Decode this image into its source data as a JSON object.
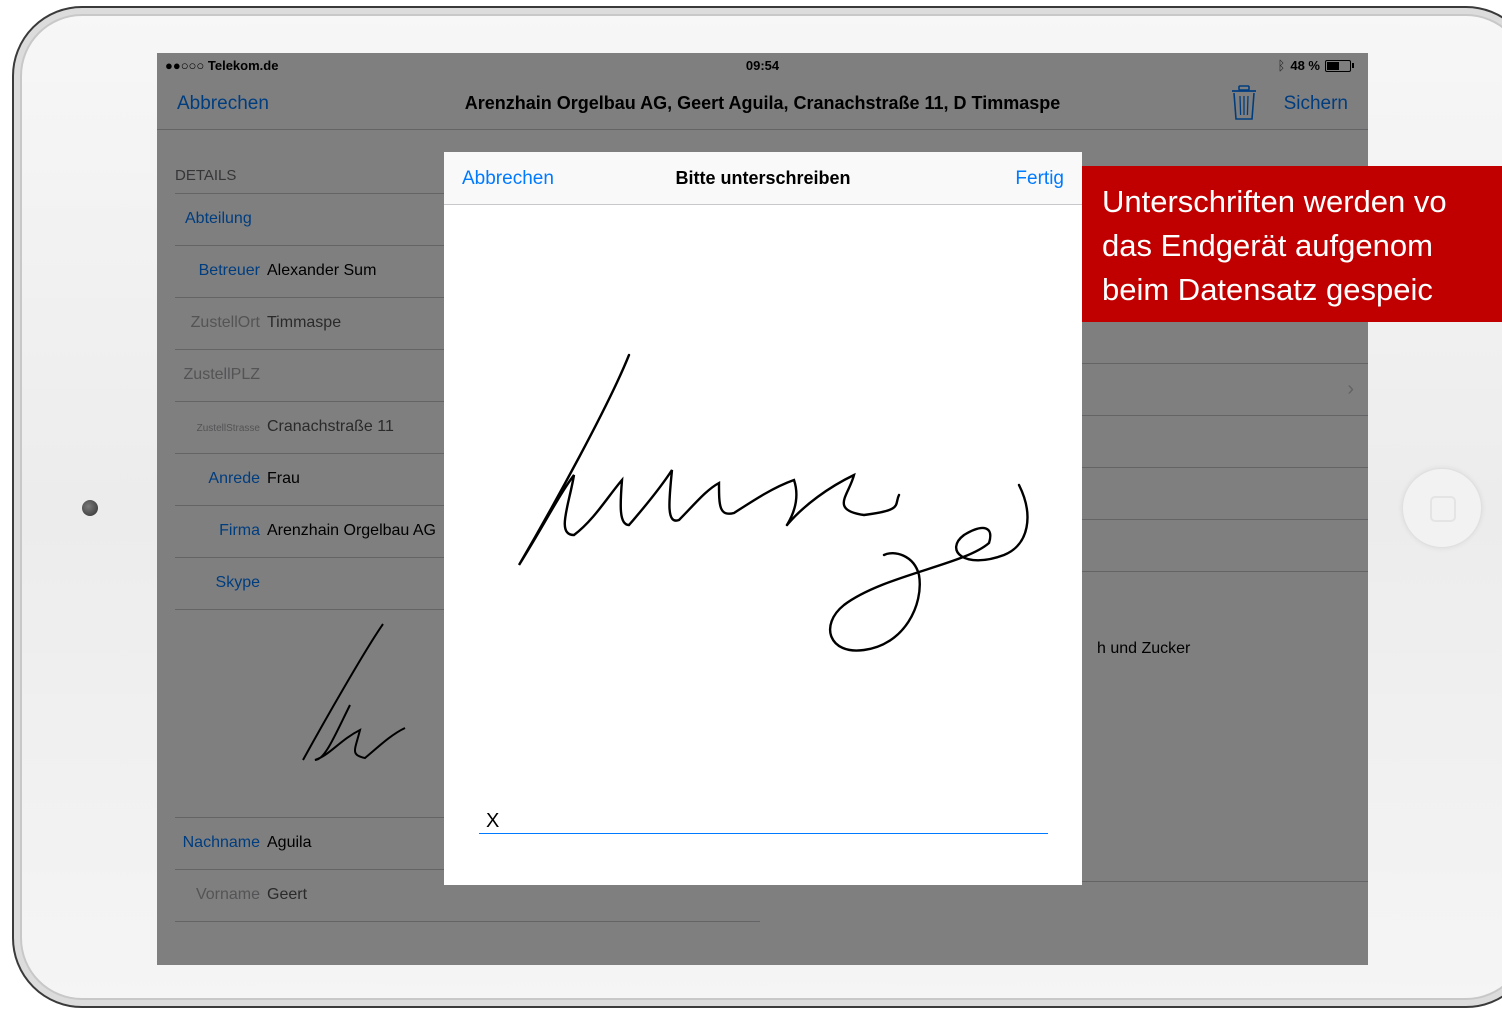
{
  "status_bar": {
    "carrier": "●●○○○ Telekom.de",
    "time": "09:54",
    "battery": "48 %"
  },
  "navbar": {
    "cancel": "Abbrechen",
    "title": "Arenzhain Orgelbau AG, Geert Aguila, Cranachstraße 11, D  Timmaspe",
    "save": "Sichern"
  },
  "details": {
    "header": "DETAILS",
    "rows": [
      {
        "label": "Abteilung",
        "value": ""
      },
      {
        "label": "Betreuer",
        "value": "Alexander Sum"
      },
      {
        "label": "ZustellOrt",
        "value": "Timmaspe"
      },
      {
        "label": "ZustellPLZ",
        "value": ""
      },
      {
        "label": "ZustellStrasse",
        "value": "Cranachstraße 11"
      },
      {
        "label": "Anrede",
        "value": "Frau"
      },
      {
        "label": "Firma",
        "value": "Arenzhain Orgelbau AG"
      },
      {
        "label": "Skype",
        "value": ""
      }
    ],
    "rows_bottom": [
      {
        "label": "Nachname",
        "value": "Aguila"
      },
      {
        "label": "Vorname",
        "value": "Geert"
      }
    ],
    "right_text": "h und Zucker"
  },
  "modal": {
    "cancel": "Abbrechen",
    "title": "Bitte unterschreiben",
    "done": "Fertig",
    "sign_mark": "X"
  },
  "callout": {
    "line1": "Unterschriften werden vo",
    "line2": "das Endgerät aufgenom",
    "line3": "beim Datensatz gespeic"
  },
  "colors": {
    "ios_blue": "#007aff",
    "callout_red": "#c00000",
    "overlay": "rgba(0,0,0,0.5)"
  }
}
